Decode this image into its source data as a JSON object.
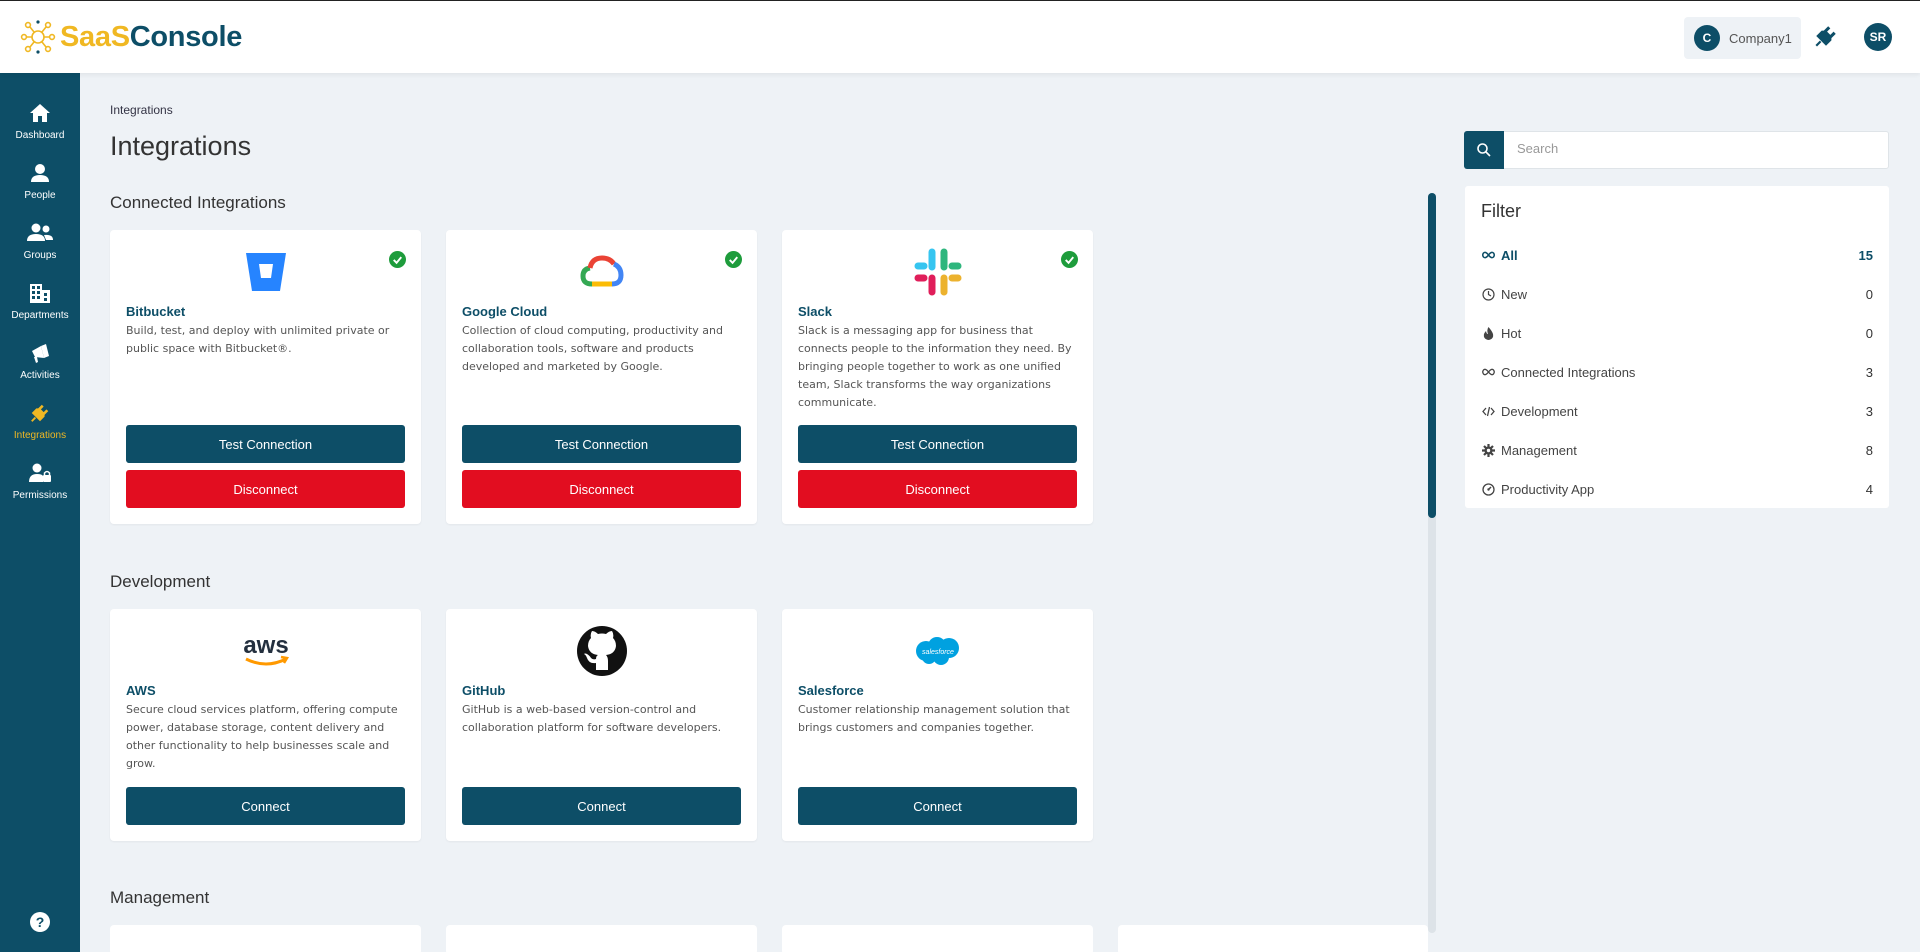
{
  "app": {
    "logo_part1": "SaaS",
    "logo_part2": "Console",
    "company_initial": "C",
    "company_name": "Company1",
    "user_initials": "SR"
  },
  "colors": {
    "brand": "#0d4e67",
    "accent": "#f0b823",
    "danger": "#e20d20",
    "success": "#1e9c3c"
  },
  "sidebar": {
    "items": [
      {
        "label": "Dashboard",
        "icon": "home-icon"
      },
      {
        "label": "People",
        "icon": "person-icon"
      },
      {
        "label": "Groups",
        "icon": "groups-icon"
      },
      {
        "label": "Departments",
        "icon": "building-icon"
      },
      {
        "label": "Activities",
        "icon": "megaphone-icon"
      },
      {
        "label": "Integrations",
        "icon": "plug-icon",
        "active": true
      },
      {
        "label": "Permissions",
        "icon": "user-lock-icon"
      }
    ],
    "help_label": "?"
  },
  "breadcrumb": "Integrations",
  "page_title": "Integrations",
  "sections": {
    "connected": {
      "title": "Connected Integrations",
      "cards": [
        {
          "name": "Bitbucket",
          "description": "Build, test, and deploy with unlimited private or public space with Bitbucket®.",
          "primary_label": "Test Connection",
          "secondary_label": "Disconnect",
          "icon": "bitbucket-logo"
        },
        {
          "name": "Google Cloud",
          "description": "Collection of cloud computing, productivity and collaboration tools, software and products developed and marketed by Google.",
          "primary_label": "Test Connection",
          "secondary_label": "Disconnect",
          "icon": "google-cloud-logo"
        },
        {
          "name": "Slack",
          "description": "Slack is a messaging app for business that connects people to the information they need. By bringing people together to work as one unified team, Slack transforms the way organizations communicate.",
          "primary_label": "Test Connection",
          "secondary_label": "Disconnect",
          "icon": "slack-logo"
        }
      ]
    },
    "development": {
      "title": "Development",
      "cards": [
        {
          "name": "AWS",
          "description": "Secure cloud services platform, offering compute power, database storage, content delivery and other functionality to help businesses scale and grow.",
          "primary_label": "Connect",
          "icon": "aws-logo",
          "logo_text": "aws"
        },
        {
          "name": "GitHub",
          "description": "GitHub is a web-based version-control and collaboration platform for software developers.",
          "primary_label": "Connect",
          "icon": "github-logo"
        },
        {
          "name": "Salesforce",
          "description": "Customer relationship management solution that brings customers and companies together.",
          "primary_label": "Connect",
          "icon": "salesforce-logo",
          "logo_text": "salesforce"
        }
      ]
    },
    "management": {
      "title": "Management"
    }
  },
  "search": {
    "placeholder": "Search"
  },
  "filter": {
    "title": "Filter",
    "items": [
      {
        "label": "All",
        "count": "15",
        "icon": "infinity-icon",
        "active": true
      },
      {
        "label": "New",
        "count": "0",
        "icon": "clock-icon"
      },
      {
        "label": "Hot",
        "count": "0",
        "icon": "fire-icon"
      },
      {
        "label": "Connected Integrations",
        "count": "3",
        "icon": "infinity-icon"
      },
      {
        "label": "Development",
        "count": "3",
        "icon": "code-icon"
      },
      {
        "label": "Management",
        "count": "8",
        "icon": "gear-icon"
      },
      {
        "label": "Productivity App",
        "count": "4",
        "icon": "gauge-icon"
      }
    ]
  }
}
